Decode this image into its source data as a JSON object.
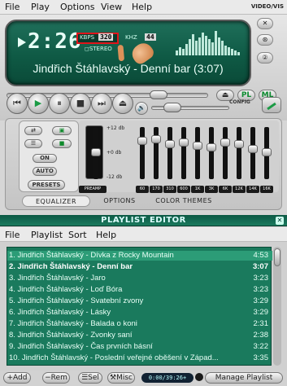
{
  "menu": {
    "file": "File",
    "play": "Play",
    "options": "Options",
    "view": "View",
    "help": "Help",
    "video_vis": "VIDEO/VIS"
  },
  "player": {
    "time": "2:26",
    "kbps_label": "KBPS",
    "kbps": "320",
    "khz_label": "KHZ",
    "khz": "44",
    "stereo_label": "STEREO",
    "title": "Jindřich Štáhlavský - Denní bar (3:07)",
    "side": [
      "",
      "⊛",
      "②"
    ],
    "pl_label": "PL",
    "ml_label": "ML",
    "config_label": "CONFIG",
    "seek_fraction": 0.78,
    "volume_fraction": 0.2
  },
  "transport": {
    "prev": "⏮",
    "play": "▶",
    "pause": "⏸",
    "stop": "■",
    "next": "⏭",
    "eject": "⏏"
  },
  "equalizer": {
    "on": "ON",
    "auto": "AUTO",
    "presets": "PRESETS",
    "db_top": "+12 db",
    "db_mid": "+0 db",
    "db_bot": "-12 db",
    "preamp": "PREAMP",
    "bands": [
      "60",
      "170",
      "310",
      "600",
      "1K",
      "3K",
      "6K",
      "12K",
      "14K",
      "16K"
    ],
    "tabs": [
      "EQUALIZER",
      "OPTIONS",
      "COLOR THEMES"
    ]
  },
  "playlist": {
    "title": "PLAYLIST EDITOR",
    "menu": [
      "File",
      "Playlist",
      "Sort",
      "Help"
    ],
    "items": [
      {
        "name": "1. Jindřich Štáhlavský - Dívka z Rocky Mountain",
        "dur": "4:53"
      },
      {
        "name": "2. Jindřich Štáhlavský - Denní bar",
        "dur": "3:07"
      },
      {
        "name": "3. Jindřich Štáhlavský - Jaro",
        "dur": "3:23"
      },
      {
        "name": "4. Jindřich Štáhlavský - Loď Bóra",
        "dur": "3:23"
      },
      {
        "name": "5. Jindřich Štáhlavský - Svatební zvony",
        "dur": "3:29"
      },
      {
        "name": "6. Jindřich Štáhlavský - Lásky",
        "dur": "3:29"
      },
      {
        "name": "7. Jindřich Štáhlavský - Balada o koni",
        "dur": "2:31"
      },
      {
        "name": "8. Jindřich Štáhlavský - Zvonky saní",
        "dur": "2:38"
      },
      {
        "name": "9. Jindřich Štáhlavský - Čas prvních básní",
        "dur": "3:22"
      },
      {
        "name": "10. Jindřich Štáhlavský - Poslední veřejné oběšení v Západ...",
        "dur": "3:35"
      }
    ],
    "bottom": {
      "add": "+Add",
      "rem": "−Rem",
      "sel": "☰Sel",
      "misc": "⚒Misc",
      "time": "0:00/39:26+",
      "manage": "Manage Playlist"
    }
  }
}
